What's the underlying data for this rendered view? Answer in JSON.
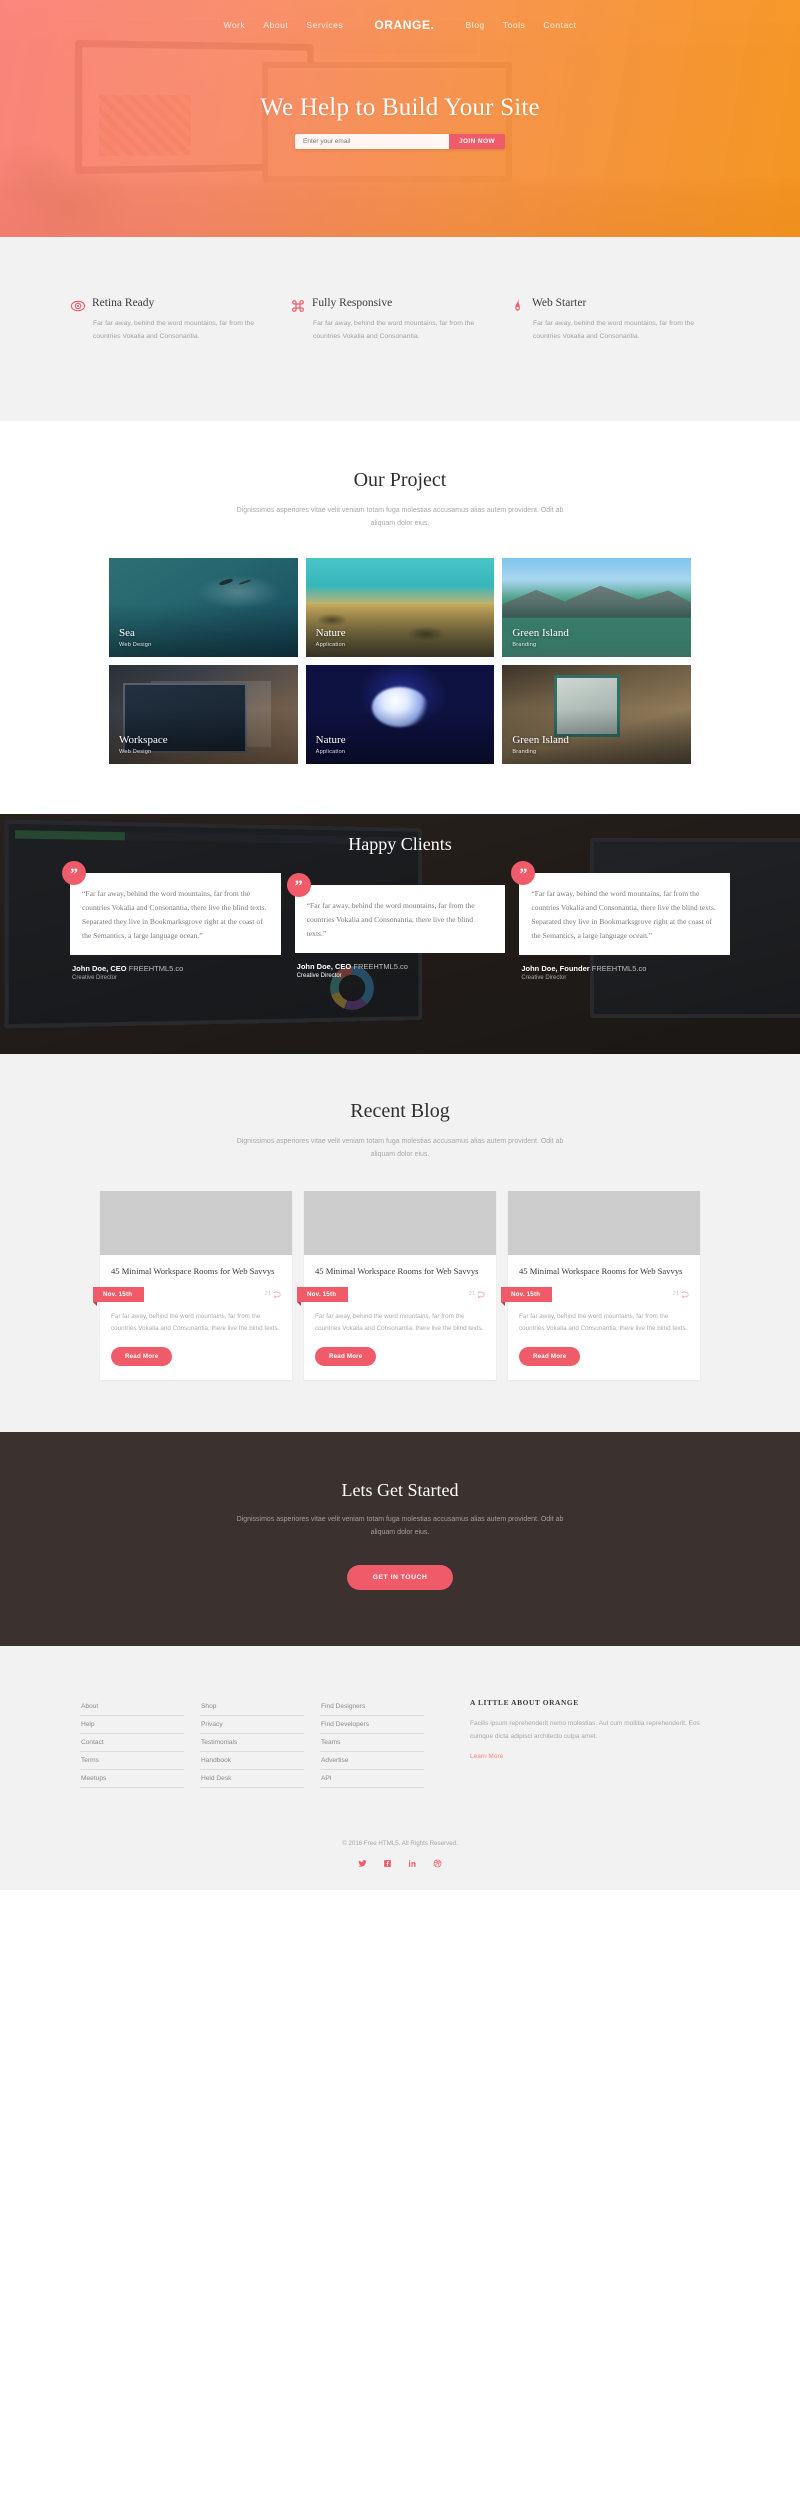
{
  "hero": {
    "nav_left": [
      {
        "label": "Work"
      },
      {
        "label": "About"
      },
      {
        "label": "Services"
      }
    ],
    "brand": "ORANGE.",
    "nav_right": [
      {
        "label": "Blog"
      },
      {
        "label": "Tools"
      },
      {
        "label": "Contact"
      }
    ],
    "title": "We Help to Build Your Site",
    "email_placeholder": "Enter your email",
    "email_value": "",
    "join_label": "JOIN NOW",
    "accent": "#ef5b68",
    "gradient_start": "#fa786e",
    "gradient_end": "#f89112"
  },
  "features": [
    {
      "icon": "eye-retina-icon",
      "title": "Retina Ready",
      "text": "Far far away, behind the word mountains, far from the countries Vokalia and Consonantia."
    },
    {
      "icon": "command-responsive-icon",
      "title": "Fully Responsive",
      "text": "Far far away, behind the word mountains, far from the countries Vokalia and Consonantia."
    },
    {
      "icon": "rocket-web-starter-icon",
      "title": "Web Starter",
      "text": "Far far away, behind the word mountains, far from the countries Vokalia and Consonantia."
    }
  ],
  "projects": {
    "title": "Our Project",
    "subtitle": "Dignissimos asperiores vitae velit veniam totam fuga molestias accusamus alias autem provident. Odit ab aliquam dolor eius.",
    "items": [
      {
        "name": "Sea",
        "category": "Web Design",
        "photo": "ph-sea"
      },
      {
        "name": "Nature",
        "category": "Application",
        "photo": "ph-nature1"
      },
      {
        "name": "Green Island",
        "category": "Branding",
        "photo": "ph-green1"
      },
      {
        "name": "Workspace",
        "category": "Web Design",
        "photo": "ph-work"
      },
      {
        "name": "Nature",
        "category": "Application",
        "photo": "ph-nature2"
      },
      {
        "name": "Green Island",
        "category": "Branding",
        "photo": "ph-green2"
      }
    ]
  },
  "clients": {
    "title": "Happy Clients",
    "testimonials": [
      {
        "quote": "“Far far away, behind the word mountains, far from the countries Vokalia and Consonantia, there live the blind texts. Separated they live in Bookmarksgrove right at the coast of the Semantics, a large language ocean.”",
        "name": "John Doe, CEO",
        "company": "FREEHTML5.co",
        "role": "Creative Director"
      },
      {
        "quote": "“Far far away, behind the word mountains, far from the countries Vokalia and Consonantia, there live the blind texts.”",
        "name": "John Doe, CEO",
        "company": "FREEHTML5.co",
        "role": "Creative Director"
      },
      {
        "quote": "“Far far away, behind the word mountains, far from the countries Vokalia and Consonantia, there live the blind texts. Separated they live in Bookmarksgrove right at the coast of the Semantics, a large language ocean.”",
        "name": "John Doe, Founder",
        "company": "FREEHTML5.co",
        "role": "Creative Director"
      }
    ]
  },
  "blog": {
    "title": "Recent Blog",
    "subtitle": "Dignissimos asperiores vitae velit veniam totam fuga molestias accusamus alias autem provident. Odit ab aliquam dolor eius.",
    "posts": [
      {
        "title": "45 Minimal Workspace Rooms for Web Savvys",
        "date": "Nov. 15th",
        "comments": "21",
        "text": "Far far away, behind the word mountains, far from the countries Vokalia and Consonantia, there live the blind texts.",
        "button": "Read More",
        "photo": "bimg-1"
      },
      {
        "title": "45 Minimal Workspace Rooms for Web Savvys",
        "date": "Nov. 15th",
        "comments": "21",
        "text": "Far far away, behind the word mountains, far from the countries Vokalia and Consonantia, there live the blind texts.",
        "button": "Read More",
        "photo": "bimg-2"
      },
      {
        "title": "45 Minimal Workspace Rooms for Web Savvys",
        "date": "Nov. 15th",
        "comments": "21",
        "text": "Far far away, behind the word mountains, far from the countries Vokalia and Consonantia, there live the blind texts.",
        "button": "Read More",
        "photo": "bimg-3"
      }
    ]
  },
  "cta": {
    "title": "Lets Get Started",
    "subtitle": "Dignissimos asperiores vitae velit veniam totam fuga molestias accusamus alias autem provident. Odit ab aliquam dolor eius.",
    "button": "GET IN TOUCH"
  },
  "footer": {
    "columns": [
      {
        "links": [
          {
            "label": "About"
          },
          {
            "label": "Help"
          },
          {
            "label": "Contact"
          },
          {
            "label": "Terms"
          },
          {
            "label": "Meetups"
          }
        ]
      },
      {
        "links": [
          {
            "label": "Shop"
          },
          {
            "label": "Privacy"
          },
          {
            "label": "Testimonials"
          },
          {
            "label": "Handbook"
          },
          {
            "label": "Held Desk"
          }
        ]
      },
      {
        "links": [
          {
            "label": "Find Designers"
          },
          {
            "label": "Find Developers"
          },
          {
            "label": "Teams"
          },
          {
            "label": "Advertise"
          },
          {
            "label": "API"
          }
        ]
      }
    ],
    "about": {
      "heading": "A LITTLE ABOUT ORANGE",
      "text": "Facilis ipsum reprehenderit nemo molestias. Aut cum mollitia reprehenderit. Eos cumque dicta adipisci architecto culpa amet.",
      "link": "Learn More"
    },
    "copyright": "© 2016 Free HTML5. All Rights Reserved.",
    "social": [
      {
        "name": "twitter-icon"
      },
      {
        "name": "facebook-icon"
      },
      {
        "name": "linkedin-icon"
      },
      {
        "name": "dribbble-icon"
      }
    ]
  }
}
